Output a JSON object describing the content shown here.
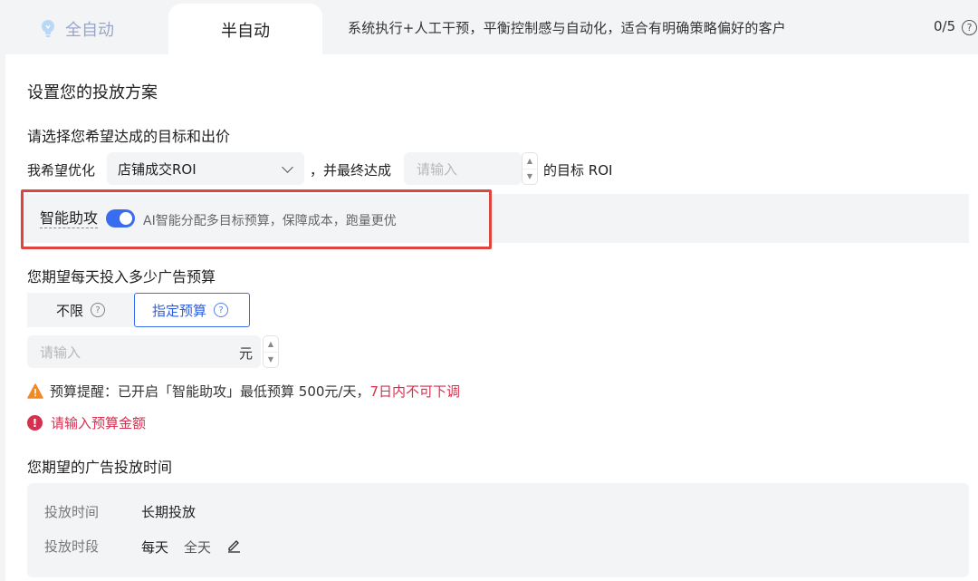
{
  "tabs": {
    "auto_label": "全自动",
    "semi_label": "半自动",
    "description": "系统执行+人工干预，平衡控制感与自动化，适合有明确策略偏好的客户",
    "count": "0/5",
    "help_glyph": "?"
  },
  "plan": {
    "title": "设置您的投放方案",
    "goal_title": "请选择您希望达成的目标和出价",
    "optimize_prefix": "我希望优化",
    "optimize_selected": "店铺成交ROI",
    "middle_text": "，并最终达成",
    "roi_placeholder": "请输入",
    "suffix_text": "的目标 ROI"
  },
  "smart_assist": {
    "label": "智能助攻",
    "enabled": true,
    "description": "AI智能分配多目标预算，保障成本，跑量更优"
  },
  "budget": {
    "title": "您期望每天投入多少广告预算",
    "option_unlimited": "不限",
    "option_fixed": "指定预算",
    "selected": "指定预算",
    "amount_placeholder": "请输入",
    "unit": "元",
    "warning_text": "预算提醒：已开启「智能助攻」最低预算 500元/天，",
    "warning_emphasis": "7日内不可下调",
    "error_text": "请输入预算金额"
  },
  "schedule": {
    "title": "您期望的广告投放时间",
    "period_key": "投放时间",
    "period_value": "长期投放",
    "slot_key": "投放时段",
    "slot_day": "每天",
    "slot_time": "全天"
  },
  "colors": {
    "accent": "#3a6cf0",
    "highlight_border": "#e0443e",
    "error": "#d6304f",
    "warning": "#f08a24"
  },
  "icons": {
    "auto_tab": "lightbulb-icon",
    "help": "question-circle-icon",
    "dropdown": "chevron-down-icon",
    "warning": "warning-triangle-icon",
    "error": "exclamation-circle-icon",
    "edit": "pencil-icon"
  }
}
